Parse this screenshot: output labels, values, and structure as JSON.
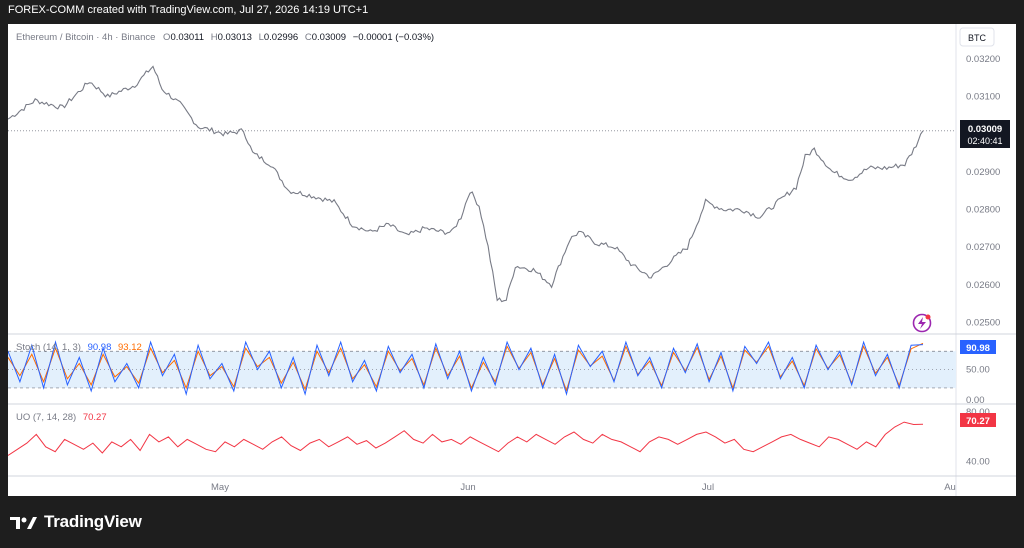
{
  "header": {
    "text": "FOREX-COMM created with TradingView.com, Jul 27, 2026 14:19 UTC+1"
  },
  "footer": {
    "brand": "TradingView"
  },
  "symbol": {
    "name": "Ethereum / Bitcoin · 4h · Binance",
    "o_label": "O",
    "o_value": "0.03011",
    "h_label": "H",
    "h_value": "0.03013",
    "l_label": "L",
    "l_value": "0.02996",
    "c_label": "C",
    "c_value": "0.03009",
    "change": "−0.00001 (−0.03%)",
    "currency": "BTC"
  },
  "price_badge": {
    "price": "0.03009",
    "countdown": "02:40:41"
  },
  "stoch_panel": {
    "label": "Stoch (14, 1, 3)",
    "k_value": "90.98",
    "d_value": "93.12",
    "badge": "90.98"
  },
  "uo_panel": {
    "label": "UO (7, 14, 28)",
    "value": "70.27",
    "badge": "70.27"
  },
  "colors": {
    "price_line": "#787b86",
    "stoch_k": "#2962ff",
    "stoch_d": "#ff6d00",
    "uo": "#f23645",
    "band_fill": "#e3f0fc",
    "badge_dark": "#131722",
    "icon_purple": "#9c27b0"
  },
  "chart_data": [
    {
      "type": "line",
      "title": "Ethereum / Bitcoin · 4h · Binance",
      "x_tick_labels": [
        "May",
        "Jun",
        "Jul",
        "Au"
      ],
      "y_ticks": [
        0.025,
        0.026,
        0.027,
        0.028,
        0.029,
        0.03,
        0.031,
        0.032
      ],
      "y_tick_labels": [
        "0.02500",
        "0.02600",
        "0.02700",
        "0.02800",
        "0.02900",
        "0.03000",
        "0.03100",
        "0.03200"
      ],
      "ylim": [
        0.0248,
        0.0325
      ],
      "series": [
        {
          "name": "ETHBTC",
          "points": [
            [
              0,
              0.0304
            ],
            [
              3,
              0.0309
            ],
            [
              6,
              0.0307
            ],
            [
              9,
              0.0314
            ],
            [
              11,
              0.031
            ],
            [
              14,
              0.0313
            ],
            [
              16,
              0.0318
            ],
            [
              17,
              0.0312
            ],
            [
              19,
              0.0308
            ],
            [
              21,
              0.0302
            ],
            [
              24,
              0.03
            ],
            [
              26,
              0.0301
            ],
            [
              27,
              0.0295
            ],
            [
              29,
              0.0292
            ],
            [
              31,
              0.0285
            ],
            [
              33,
              0.0284
            ],
            [
              36,
              0.0282
            ],
            [
              38,
              0.0276
            ],
            [
              40,
              0.0274
            ],
            [
              42,
              0.0276
            ],
            [
              44,
              0.0273
            ],
            [
              46,
              0.0275
            ],
            [
              48,
              0.0274
            ],
            [
              49,
              0.0274
            ],
            [
              50,
              0.0278
            ],
            [
              51,
              0.0285
            ],
            [
              52,
              0.0281
            ],
            [
              53,
              0.027
            ],
            [
              54,
              0.0256
            ],
            [
              55,
              0.0256
            ],
            [
              56,
              0.0265
            ],
            [
              58,
              0.0264
            ],
            [
              60,
              0.026
            ],
            [
              62,
              0.0272
            ],
            [
              63,
              0.0274
            ],
            [
              65,
              0.0271
            ],
            [
              67,
              0.027
            ],
            [
              69,
              0.0265
            ],
            [
              71,
              0.0262
            ],
            [
              73,
              0.0266
            ],
            [
              75,
              0.027
            ],
            [
              77,
              0.0282
            ],
            [
              79,
              0.028
            ],
            [
              81,
              0.028
            ],
            [
              83,
              0.0278
            ],
            [
              85,
              0.0282
            ],
            [
              87,
              0.0286
            ],
            [
              88,
              0.0294
            ],
            [
              89,
              0.0296
            ],
            [
              91,
              0.029
            ],
            [
              93,
              0.0288
            ],
            [
              95,
              0.0291
            ],
            [
              97,
              0.0291
            ],
            [
              99,
              0.0292
            ],
            [
              100,
              0.0296
            ],
            [
              101,
              0.03009
            ]
          ]
        }
      ]
    },
    {
      "type": "line",
      "title": "Stoch (14, 1, 3)",
      "y_ticks": [
        0,
        50,
        100
      ],
      "y_tick_labels": [
        "0.00",
        "50.00",
        ""
      ],
      "bands": [
        20,
        80
      ],
      "ylim": [
        -3,
        105
      ],
      "series": [
        {
          "name": "%K",
          "values": [
            80,
            30,
            90,
            20,
            95,
            25,
            70,
            15,
            85,
            30,
            60,
            20,
            95,
            40,
            75,
            10,
            90,
            35,
            60,
            15,
            95,
            50,
            80,
            20,
            70,
            10,
            90,
            40,
            95,
            30,
            65,
            15,
            88,
            45,
            75,
            20,
            92,
            35,
            80,
            15,
            70,
            25,
            95,
            50,
            85,
            20,
            75,
            10,
            90,
            55,
            80,
            30,
            95,
            40,
            70,
            20,
            85,
            45,
            92,
            30,
            78,
            15,
            88,
            60,
            95,
            35,
            70,
            20,
            90,
            50,
            80,
            25,
            95,
            40,
            75,
            20,
            90,
            91
          ]
        },
        {
          "name": "%D",
          "values": [
            70,
            40,
            75,
            30,
            85,
            35,
            60,
            25,
            75,
            38,
            55,
            28,
            85,
            45,
            65,
            20,
            80,
            40,
            55,
            22,
            85,
            55,
            70,
            28,
            62,
            18,
            80,
            45,
            85,
            35,
            58,
            22,
            80,
            48,
            68,
            25,
            85,
            40,
            72,
            20,
            62,
            30,
            88,
            52,
            78,
            25,
            68,
            16,
            82,
            56,
            72,
            32,
            88,
            42,
            64,
            24,
            78,
            48,
            86,
            34,
            72,
            20,
            82,
            62,
            88,
            38,
            64,
            24,
            84,
            52,
            74,
            28,
            88,
            44,
            70,
            24,
            84,
            93
          ]
        }
      ]
    },
    {
      "type": "line",
      "title": "UO (7, 14, 28)",
      "y_ticks": [
        40,
        80
      ],
      "y_tick_labels": [
        "40.00",
        "80.00"
      ],
      "ylim": [
        30,
        85
      ],
      "series": [
        {
          "name": "UO",
          "values": [
            45,
            50,
            55,
            62,
            52,
            48,
            58,
            54,
            50,
            55,
            47,
            56,
            52,
            58,
            49,
            62,
            56,
            60,
            52,
            58,
            54,
            50,
            48,
            56,
            52,
            58,
            54,
            50,
            56,
            60,
            53,
            49,
            55,
            58,
            52,
            56,
            60,
            54,
            57,
            51,
            55,
            60,
            65,
            58,
            55,
            62,
            56,
            58,
            54,
            60,
            56,
            52,
            48,
            55,
            60,
            56,
            62,
            58,
            54,
            60,
            64,
            58,
            55,
            62,
            58,
            56,
            52,
            48,
            56,
            60,
            58,
            54,
            58,
            62,
            64,
            60,
            55,
            58,
            50,
            48,
            52,
            56,
            60,
            62,
            58,
            55,
            52,
            60,
            58,
            54,
            50,
            56,
            52,
            62,
            68,
            72,
            70,
            70.27
          ]
        }
      ]
    }
  ]
}
